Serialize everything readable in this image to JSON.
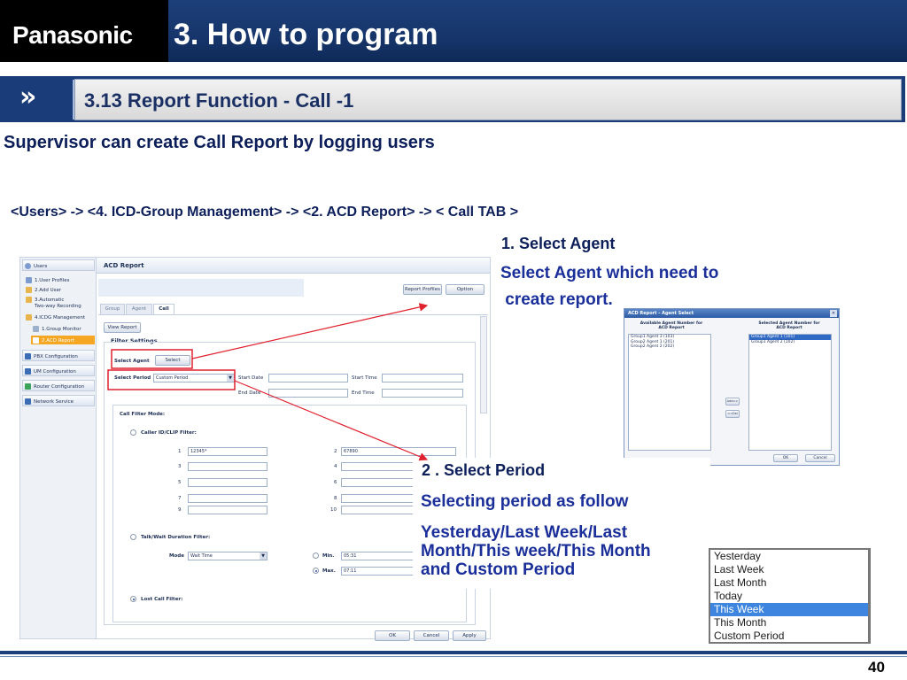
{
  "header": {
    "logo": "Panasonic",
    "title": "3. How to program"
  },
  "section": {
    "arrow": "»",
    "title": "3.13 Report Function  -  Call -1"
  },
  "subtitle": "Supervisor can create Call Report by logging users",
  "nav_path": "<Users> -> <4. ICD-Group Management> -> <2. ACD Report> -> < Call TAB >",
  "annotation1": {
    "title": "1. Select Agent",
    "line1": "Select Agent  which need to",
    "line2": " create report."
  },
  "annotation2": {
    "title": "2 . Select Period",
    "subtitle": "Selecting period as follow",
    "line1": "Yesterday/Last Week/Last",
    "line2": "Month/This week/This Month",
    "line3": "and Custom Period"
  },
  "app": {
    "sidebar": {
      "users": "Users",
      "user_profiles": "1.User Profiles",
      "add_user": "2.Add User",
      "auto_rec_1": "3.Automatic",
      "auto_rec_2": "Two-way Recording",
      "icdg": "4.ICDG Management",
      "group_monitor": "1.Group Monitor",
      "acd_report": "2.ACD Report",
      "pbx": "PBX Configuration",
      "um": "UM Configuration",
      "router": "Router Configuration",
      "network": "Network Service"
    },
    "panel_title": "ACD Report",
    "report_profiles": "Report Profiles",
    "option": "Option",
    "tabs": {
      "group": "Group",
      "agent": "Agent",
      "call": "Call"
    },
    "view_report": "View Report",
    "filter_settings": "Filter Settings",
    "select_agent_label": "Select Agent",
    "select_btn": "Select",
    "select_period_label": "Select Period",
    "period_value": "Custom Period",
    "start_date": "Start Date",
    "end_date": "End Date",
    "start_time": "Start Time",
    "end_time": "End Time",
    "call_filter_mode": "Call Filter Mode:",
    "caller_filter": "Caller ID/CLIP Filter:",
    "caller_rows": [
      {
        "n1": "1",
        "v1": "12345*",
        "n2": "2",
        "v2": "67890"
      },
      {
        "n1": "3",
        "v1": "",
        "n2": "4",
        "v2": ""
      },
      {
        "n1": "5",
        "v1": "",
        "n2": "6",
        "v2": ""
      },
      {
        "n1": "7",
        "v1": "",
        "n2": "8",
        "v2": ""
      },
      {
        "n1": "9",
        "v1": "",
        "n2": "10",
        "v2": ""
      }
    ],
    "talk_filter": "Talk/Wait Duration Filter:",
    "mode_label": "Mode",
    "mode_value": "Wait Time",
    "min_label": "Min.",
    "min_value": "05:31",
    "max_label": "Max.",
    "max_value": "07:11",
    "lost_call": "Lost Call Filter:",
    "ok": "OK",
    "cancel": "Cancel",
    "apply": "Apply"
  },
  "agent_dialog": {
    "title": "ACD Report - Agent Select",
    "available_head_1": "Available Agent Number for",
    "available_head_2": "ACD Report",
    "selected_head_1": "Selected Agent Number for",
    "selected_head_2": "ACD Report",
    "available": [
      "Group1 Agent 3 (103)",
      "Group2 Agent 1 (201)",
      "Group2 Agent 2 (202)"
    ],
    "selected": [
      "Group1 Agent 1 (101)",
      "Group1 Agent 2 (102)"
    ],
    "add": "Add>>",
    "del": "<<Del",
    "ok": "OK",
    "cancel": "Cancel"
  },
  "period_list": {
    "items": [
      "Yesterday",
      "Last Week",
      "Last Month",
      "Today",
      "This Week",
      "This Month",
      "Custom Period"
    ],
    "selected_index": 4
  },
  "page_number": "40",
  "colors": {
    "brand_navy": "#1a3d79",
    "annotation_red": "#e0212e",
    "text_blue": "#1a2f9a"
  }
}
